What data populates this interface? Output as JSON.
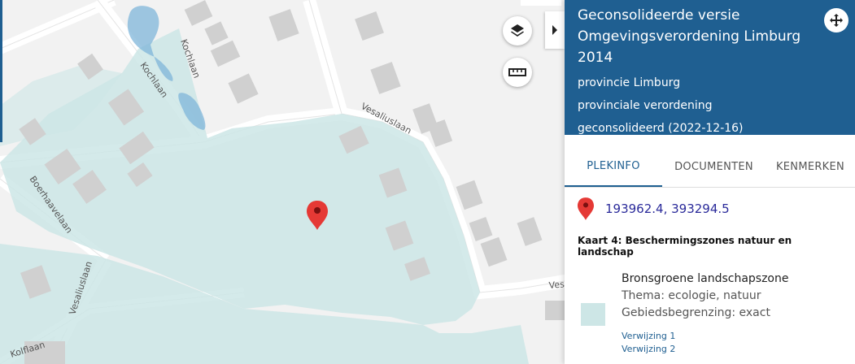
{
  "map": {
    "streets": {
      "kochlaan_1": "Kochlaan",
      "kochlaan_2": "Kochlaan",
      "vesaliuslaan_1": "Vesaliuslaan",
      "vesaliuslaan_2": "Vesaliuslaan",
      "vesaliuslaan_3": "Vesa",
      "boerhaavelaan": "Boerhaavelaan",
      "kolflaan": "Kolflaan"
    },
    "zone_color": "#cde6e6",
    "water_color": "#7fb5d9",
    "marker_color": "#e53935",
    "controls": {
      "layers_icon": "layers-icon",
      "measure_icon": "ruler-icon",
      "collapse_icon": "chevron-right-icon"
    }
  },
  "panel": {
    "title": "Geconsolideerde versie Omgevingsverordening Limburg 2014",
    "authority": "provincie Limburg",
    "doc_type": "provinciale verordening",
    "status": "geconsolideerd (2022-12-16)",
    "header_color": "#1f5f91",
    "tabs": [
      {
        "label": "PLEKINFO",
        "active": true
      },
      {
        "label": "DOCUMENTEN",
        "active": false
      },
      {
        "label": "KENMERKEN",
        "active": false
      }
    ],
    "coordinates": "193962.4, 393294.5",
    "kaart_title": "Kaart 4: Beschermingszones natuur en landschap",
    "zone": {
      "name": "Bronsgroene landschapszone",
      "thema": "Thema: ecologie, natuur",
      "begrenzing": "Gebiedsbegrenzing: exact"
    },
    "references": [
      "Verwijzing 1",
      "Verwijzing 2"
    ]
  }
}
